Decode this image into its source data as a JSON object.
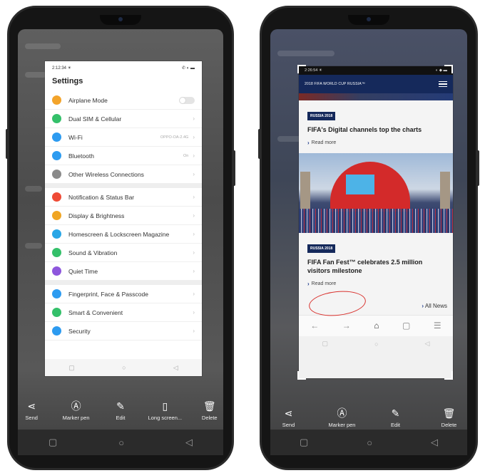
{
  "left_phone": {
    "status_time": "2:12:34 ☀",
    "status_icons": "✆ ◐ ▬",
    "settings_title": "Settings",
    "groups": [
      [
        {
          "label": "Airplane Mode",
          "icon_color": "#f3a42b",
          "icon": "airplane-icon",
          "toggle": true
        },
        {
          "label": "Dual SIM & Cellular",
          "icon_color": "#34c06a",
          "icon": "sim-icon"
        },
        {
          "label": "Wi-Fi",
          "icon_color": "#2d9bf0",
          "icon": "wifi-icon",
          "value": "OPPO-OA-2.4G"
        },
        {
          "label": "Bluetooth",
          "icon_color": "#2d9bf0",
          "icon": "bluetooth-icon",
          "value": "On"
        },
        {
          "label": "Other Wireless Connections",
          "icon_color": "#8a8a8a",
          "icon": "link-icon"
        }
      ],
      [
        {
          "label": "Notification & Status Bar",
          "icon_color": "#ef4b36",
          "icon": "bell-icon"
        },
        {
          "label": "Display & Brightness",
          "icon_color": "#f0a523",
          "icon": "brightness-icon"
        },
        {
          "label": "Homescreen & Lockscreen Magazine",
          "icon_color": "#29a6e6",
          "icon": "homescreen-icon"
        },
        {
          "label": "Sound & Vibration",
          "icon_color": "#34c06a",
          "icon": "sound-icon"
        },
        {
          "label": "Quiet Time",
          "icon_color": "#8e57dd",
          "icon": "moon-icon"
        }
      ],
      [
        {
          "label": "Fingerprint, Face & Passcode",
          "icon_color": "#2d9bf0",
          "icon": "fingerprint-icon"
        },
        {
          "label": "Smart & Convenient",
          "icon_color": "#34c06a",
          "icon": "smart-icon"
        },
        {
          "label": "Security",
          "icon_color": "#2d9bf0",
          "icon": "shield-icon"
        }
      ]
    ],
    "toolbar": [
      {
        "label": "Send",
        "glyph": "⋖",
        "icon": "share-icon"
      },
      {
        "label": "Marker pen",
        "glyph": "Ⓐ",
        "icon": "marker-pen-icon"
      },
      {
        "label": "Edit",
        "glyph": "✎",
        "icon": "edit-wand-icon"
      },
      {
        "label": "Long screen...",
        "glyph": "▯",
        "icon": "long-screenshot-icon"
      },
      {
        "label": "Delete",
        "glyph": "🗑",
        "icon": "trash-icon"
      }
    ]
  },
  "right_phone": {
    "status_time": "2:26:54 ☀",
    "status_icons": "◐ ◆ ▬",
    "site_title": "2018 FIFA WORLD CUP RUSSIA™",
    "articles": [
      {
        "tag": "RUSSIA 2018",
        "headline": "FIFA's Digital channels top the charts",
        "read_more": "Read more"
      },
      {
        "tag": "RUSSIA 2018",
        "headline": "FIFA Fan Fest™ celebrates 2.5 million visitors milestone",
        "read_more": "Read more"
      }
    ],
    "all_news": "All News",
    "toolbar": [
      {
        "label": "Send",
        "glyph": "⋖",
        "icon": "share-icon"
      },
      {
        "label": "Marker pen",
        "glyph": "Ⓐ",
        "icon": "marker-pen-icon"
      },
      {
        "label": "Edit",
        "glyph": "✎",
        "icon": "edit-wand-icon"
      },
      {
        "label": "Delete",
        "glyph": "🗑",
        "icon": "trash-icon"
      }
    ],
    "annotation_color": "#d9322e"
  }
}
